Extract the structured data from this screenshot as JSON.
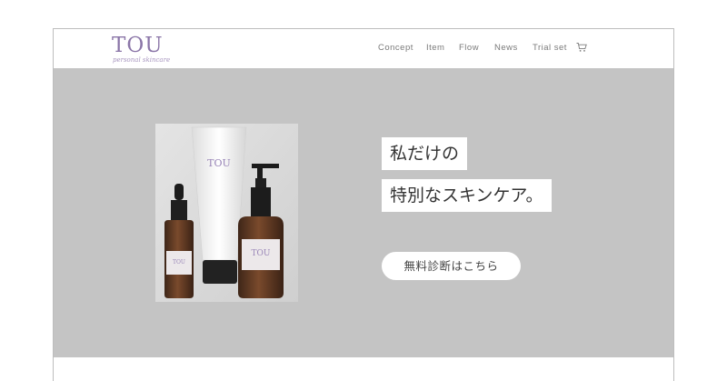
{
  "brand": {
    "name": "TOU",
    "tagline": "personal skincare"
  },
  "nav": {
    "items": [
      {
        "label": "Concept"
      },
      {
        "label": "Item"
      },
      {
        "label": "Flow"
      },
      {
        "label": "News"
      },
      {
        "label": "Trial set"
      }
    ],
    "cart_icon": "cart-icon"
  },
  "hero": {
    "headline_line1": "私だけの",
    "headline_line2": "特別なスキンケア。",
    "cta_label": "無料診断はこちら",
    "product_photo": {
      "tube_label": "TOU",
      "dropper_label": "TOU",
      "pump_label": "TOU"
    }
  },
  "colors": {
    "brand_purple": "#8b76a8",
    "hero_background": "#c4c4c4",
    "nav_text": "#7a7a7a"
  }
}
